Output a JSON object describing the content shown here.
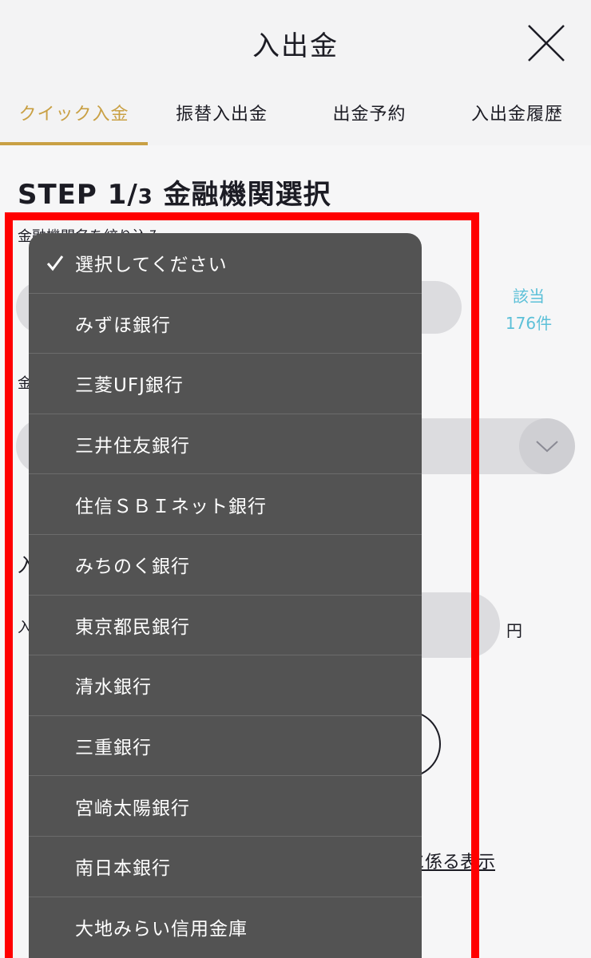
{
  "header": {
    "title": "入出金"
  },
  "tabs": [
    {
      "label": "クイック入金",
      "active": true
    },
    {
      "label": "振替入出金",
      "active": false
    },
    {
      "label": "出金予約",
      "active": false
    },
    {
      "label": "入出金履歴",
      "active": false
    }
  ],
  "step": {
    "main": "STEP 1/",
    "num": "3",
    "name": " 金融機関選択"
  },
  "filter": {
    "label": "金融機関名を絞り込み"
  },
  "result": {
    "label": "該当",
    "count": "176件"
  },
  "bank_field": {
    "label": "金"
  },
  "amount": {
    "heading": "入",
    "label": "入",
    "unit": "円"
  },
  "link": {
    "text": "に係る表示"
  },
  "picker": {
    "selected_index": 0,
    "items": [
      "選択してください",
      "みずほ銀行",
      "三菱UFJ銀行",
      "三井住友銀行",
      "住信ＳＢＩネット銀行",
      "みちのく銀行",
      "東京都民銀行",
      "清水銀行",
      "三重銀行",
      "宮崎太陽銀行",
      "南日本銀行",
      "大地みらい信用金庫"
    ]
  },
  "colors": {
    "accent": "#c9a044",
    "count_text": "#5cc0d8",
    "picker_bg": "#535353",
    "highlight_frame": "#ff0000"
  }
}
